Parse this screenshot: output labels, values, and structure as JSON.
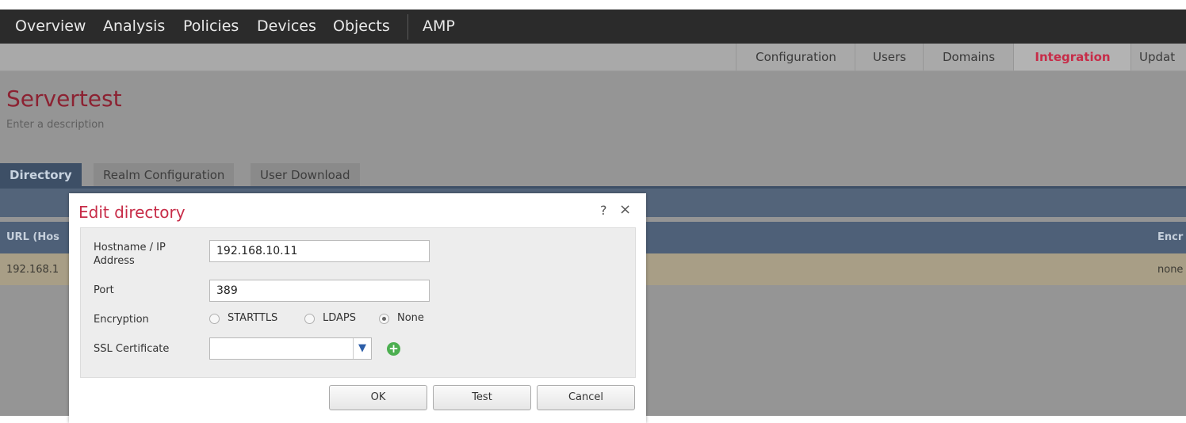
{
  "topnav": {
    "items": [
      "Overview",
      "Analysis",
      "Policies",
      "Devices",
      "Objects",
      "AMP"
    ]
  },
  "subnav": {
    "tabs": [
      "Configuration",
      "Users",
      "Domains",
      "Integration",
      "Updat"
    ],
    "active": "Integration"
  },
  "page": {
    "title": "Servertest",
    "description": "Enter a description"
  },
  "tabs": {
    "items": [
      "Directory",
      "Realm Configuration",
      "User Download"
    ],
    "active": "Directory"
  },
  "table": {
    "header_left": "URL (Hos",
    "header_right": "Encr",
    "row_left": "192.168.1",
    "row_right": "none"
  },
  "dialog": {
    "title": "Edit directory",
    "help_icon": "?",
    "close_icon": "×",
    "fields": {
      "hostname_label": "Hostname / IP Address",
      "hostname_value": "192.168.10.11",
      "port_label": "Port",
      "port_value": "389",
      "encryption_label": "Encryption",
      "encryption_options": [
        "STARTTLS",
        "LDAPS",
        "None"
      ],
      "encryption_selected": "None",
      "ssl_label": "SSL Certificate",
      "ssl_value": ""
    },
    "buttons": {
      "ok": "OK",
      "test": "Test",
      "cancel": "Cancel"
    }
  },
  "colors": {
    "accent": "#c72c48",
    "nav_bg": "#2b2b2b",
    "tab_active_bg": "#3d4f66",
    "add_icon": "#4caf50"
  }
}
